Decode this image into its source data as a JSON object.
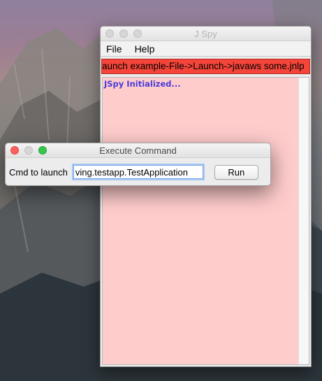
{
  "main_window": {
    "title": "J Spy",
    "menu": [
      {
        "label": "File"
      },
      {
        "label": "Help"
      }
    ],
    "command_strip_text": "aunch example-File->Launch->javaws some.jnlp",
    "log_text": "JSpy Initialized...",
    "colors": {
      "command_strip": "#f5453a",
      "log_background": "#ffcccc",
      "log_text": "#4a3cd8"
    }
  },
  "exec_dialog": {
    "title": "Execute Command",
    "field_label": "Cmd to launch",
    "command_value": "ving.testapp.TestApplication",
    "run_label": "Run"
  }
}
